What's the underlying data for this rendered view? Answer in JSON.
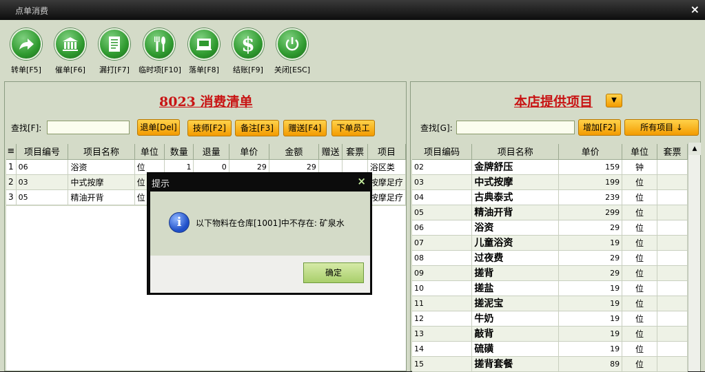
{
  "window": {
    "title": "点单消费",
    "close": "×"
  },
  "toolbar": [
    {
      "label": "转单[F5]",
      "icon": "forward-arrow-icon"
    },
    {
      "label": "催单[F6]",
      "icon": "bank-icon"
    },
    {
      "label": "漏打[F7]",
      "icon": "document-icon"
    },
    {
      "label": "临时项[F10]",
      "icon": "cutlery-icon"
    },
    {
      "label": "落单[F8]",
      "icon": "tray-icon"
    },
    {
      "label": "结账[F9]",
      "icon": "dollar-icon"
    },
    {
      "label": "关闭[ESC]",
      "icon": "power-icon"
    }
  ],
  "left": {
    "title": "8023  消费清单",
    "search_label": "查找[F]:",
    "search_value": "",
    "buttons": [
      "退单[Del]",
      "技师[F2]",
      "备注[F3]",
      "赠送[F4]",
      "下单员工"
    ],
    "columns": [
      "≡",
      "项目编号",
      "项目名称",
      "单位",
      "数量",
      "退量",
      "单价",
      "金额",
      "赠送",
      "套票",
      "项目"
    ],
    "rows": [
      [
        "1",
        "06",
        "浴资",
        "位",
        "1",
        "0",
        "29",
        "29",
        "",
        "",
        "浴区类"
      ],
      [
        "2",
        "03",
        "中式按摩",
        "位",
        "",
        "",
        "",
        "",
        "",
        "",
        "按摩足疗"
      ],
      [
        "3",
        "05",
        "精油开背",
        "位",
        "",
        "",
        "",
        "",
        "",
        "",
        "按摩足疗"
      ]
    ]
  },
  "right": {
    "title": "本店提供项目",
    "search_label": "查找[G]:",
    "search_value": "",
    "buttons": [
      "增加[F2]",
      "所有项目 ↓"
    ],
    "columns": [
      "项目编码",
      "项目名称",
      "单价",
      "单位",
      "套票"
    ],
    "rows": [
      [
        "02",
        "金牌舒压",
        "159",
        "钟",
        ""
      ],
      [
        "03",
        "中式按摩",
        "199",
        "位",
        ""
      ],
      [
        "04",
        "古典泰式",
        "239",
        "位",
        ""
      ],
      [
        "05",
        "精油开背",
        "299",
        "位",
        ""
      ],
      [
        "06",
        "浴资",
        "29",
        "位",
        ""
      ],
      [
        "07",
        "儿童浴资",
        "19",
        "位",
        ""
      ],
      [
        "08",
        "过夜费",
        "29",
        "位",
        ""
      ],
      [
        "09",
        "搓背",
        "29",
        "位",
        ""
      ],
      [
        "10",
        "搓盐",
        "19",
        "位",
        ""
      ],
      [
        "11",
        "搓泥宝",
        "19",
        "位",
        ""
      ],
      [
        "12",
        "牛奶",
        "19",
        "位",
        ""
      ],
      [
        "13",
        "敲背",
        "19",
        "位",
        ""
      ],
      [
        "14",
        "硫磺",
        "19",
        "位",
        ""
      ],
      [
        "15",
        "搓背套餐",
        "89",
        "位",
        ""
      ]
    ]
  },
  "dialog": {
    "title": "提示",
    "close": "×",
    "icon": "info-icon",
    "message": "以下物料在仓库[1001]中不存在: 矿泉水",
    "ok": "确定"
  }
}
